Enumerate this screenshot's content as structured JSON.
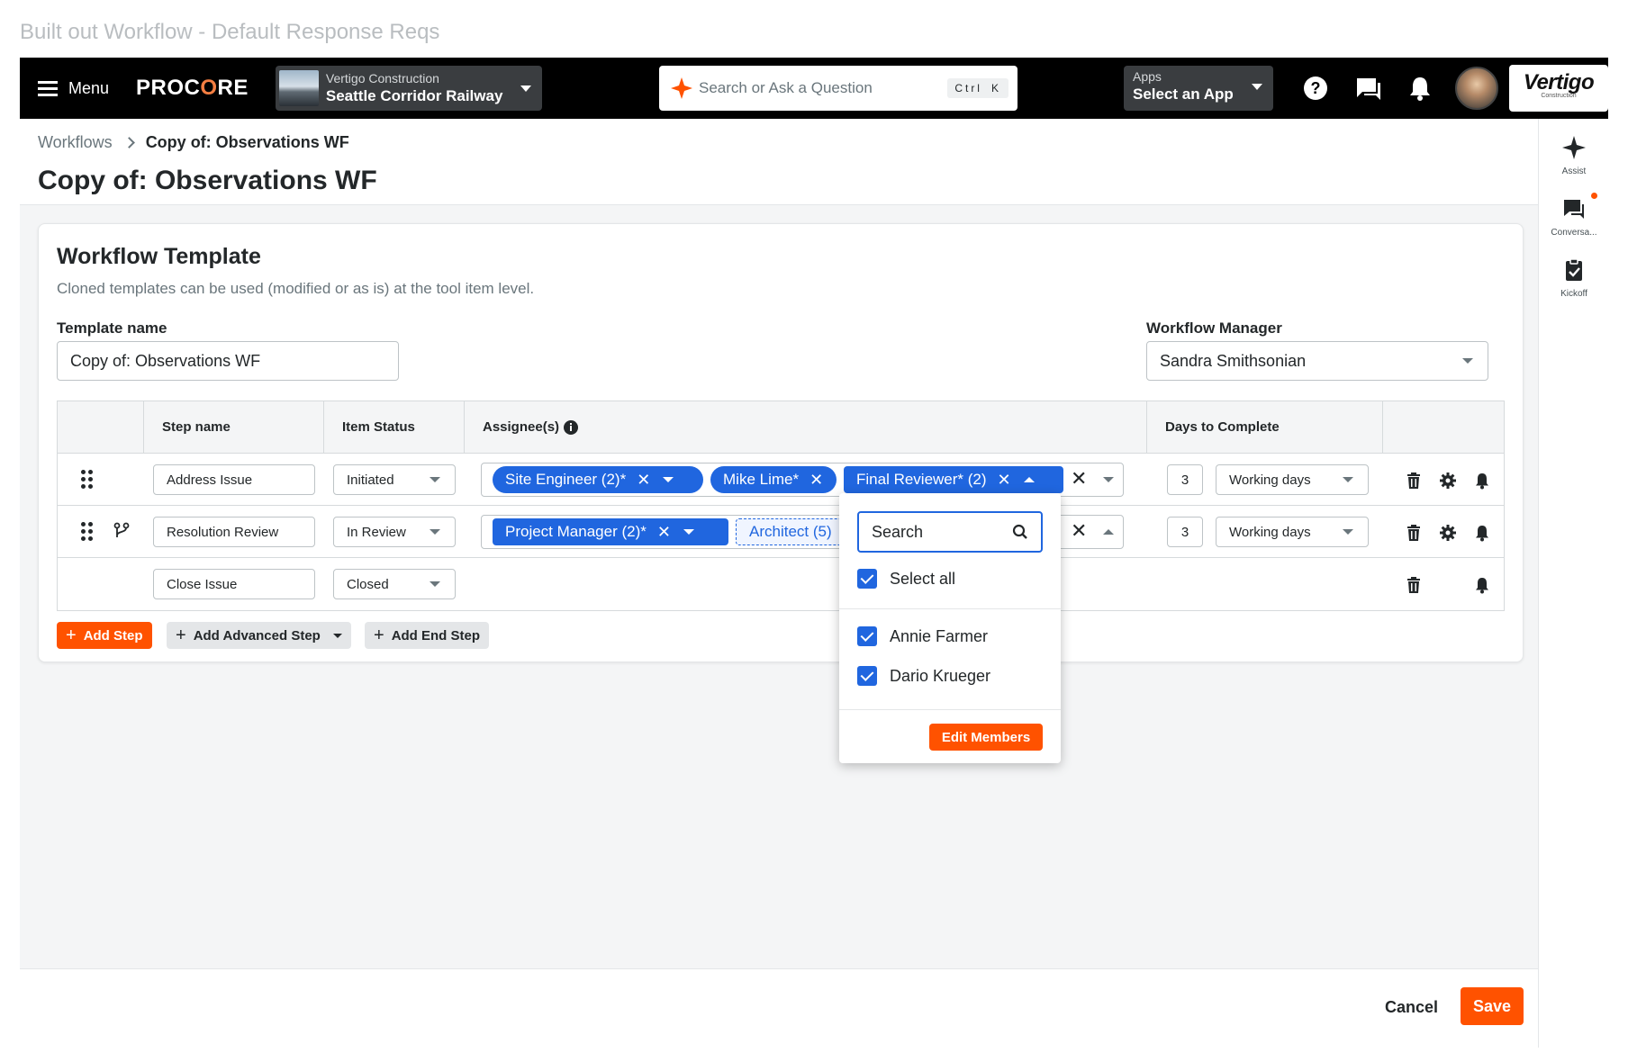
{
  "document_title": "Built out Workflow - Default Response Reqs",
  "nav": {
    "menu_label": "Menu",
    "logo_text": "PROCORE",
    "project": {
      "company": "Vertigo Construction",
      "name": "Seattle Corridor Railway"
    },
    "search_placeholder": "Search or Ask a Question",
    "shortcut_ctrl": "Ctrl",
    "shortcut_key": "K",
    "apps": {
      "label": "Apps",
      "value": "Select an App"
    },
    "company_logo": {
      "name": "Vertigo",
      "sub": "Construction"
    },
    "icons": [
      "help-icon",
      "chat-icon",
      "bell-icon"
    ]
  },
  "rail": {
    "items": [
      {
        "label": "Assist",
        "icon": "sparkle-icon"
      },
      {
        "label": "Conversa...",
        "icon": "conversation-icon"
      },
      {
        "label": "Kickoff",
        "icon": "clipboard-check-icon"
      }
    ],
    "notification_color": "#ff5200"
  },
  "breadcrumb": {
    "root": "Workflows",
    "current": "Copy of: Observations WF"
  },
  "page_title": "Copy of: Observations WF",
  "card": {
    "title": "Workflow Template",
    "subtitle": "Cloned templates can be used (modified or as is) at the tool item level.",
    "template_name_label": "Template name",
    "template_name_value": "Copy of: Observations WF",
    "manager_label": "Workflow Manager",
    "manager_value": "Sandra Smithsonian"
  },
  "table": {
    "headers": {
      "step": "Step name",
      "status": "Item Status",
      "assignees": "Assignee(s)",
      "days": "Days to Complete"
    },
    "rows": [
      {
        "step": "Address Issue",
        "status": "Initiated",
        "chips": [
          {
            "label": "Site Engineer (2)*"
          },
          {
            "label": "Mike Lime*"
          },
          {
            "label": "Final Reviewer* (2)"
          }
        ],
        "days": "3",
        "day_type": "Working days"
      },
      {
        "step": "Resolution Review",
        "status": "In Review",
        "chips": [
          {
            "label": "Project Manager (2)*"
          },
          {
            "label": "Architect (5)"
          }
        ],
        "days": "3",
        "day_type": "Working days"
      },
      {
        "step": "Close Issue",
        "status": "Closed"
      }
    ]
  },
  "buttons": {
    "add_step": "Add Step",
    "add_advanced_step": "Add Advanced Step",
    "add_end_step": "Add End Step",
    "cancel": "Cancel",
    "save": "Save"
  },
  "popover": {
    "search_placeholder": "Search",
    "select_all": "Select all",
    "members": [
      "Annie Farmer",
      "Dario Krueger"
    ],
    "edit_members": "Edit Members"
  },
  "colors": {
    "accent": "#ff5200",
    "chip_blue": "#2066df",
    "nav_bg": "#000000"
  }
}
